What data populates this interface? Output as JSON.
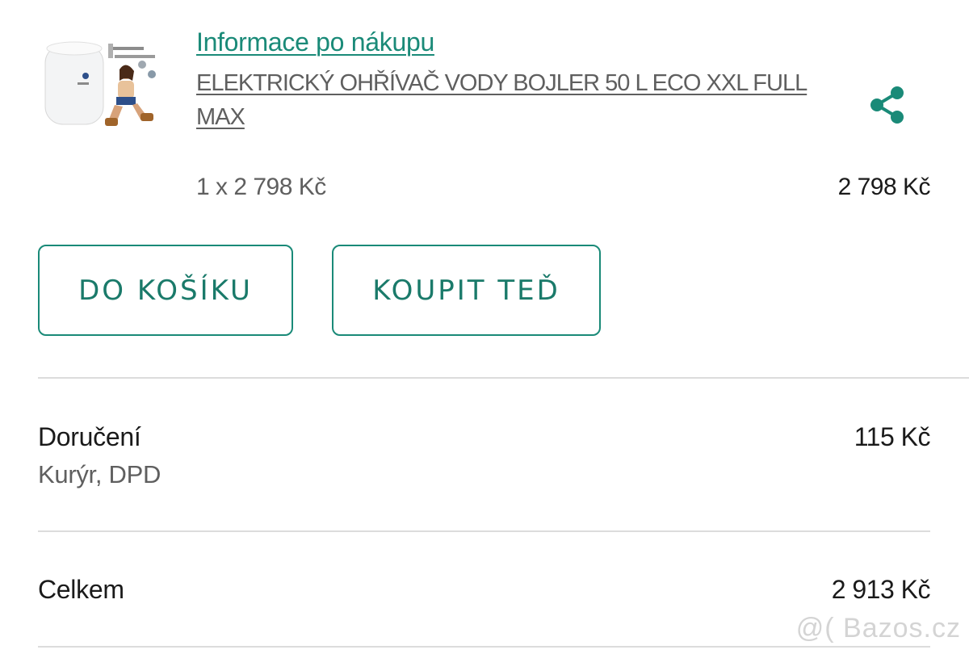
{
  "item": {
    "heading": "Informace po nákupu",
    "name": "ELEKTRICKÝ OHŘÍVAČ VODY BOJLER 50 L ECO XXL FULL MAX",
    "quantity_price": "1 x 2 798 Kč",
    "line_total": "2 798 Kč",
    "thumbnail_icon": "water-heater-product-image"
  },
  "actions": {
    "add_to_cart": "DO KOŠÍKU",
    "buy_now": "KOUPIT TEĎ",
    "share_icon": "share-icon"
  },
  "delivery": {
    "label": "Doručení",
    "method": "Kurýr, DPD",
    "price": "115 Kč"
  },
  "total": {
    "label": "Celkem",
    "price": "2 913 Kč"
  },
  "watermark": "@( Bazos.cz",
  "colors": {
    "accent": "#1a8a78",
    "text": "#1a1a1a",
    "muted": "#5f5f5f",
    "divider": "#dcdcdc"
  }
}
